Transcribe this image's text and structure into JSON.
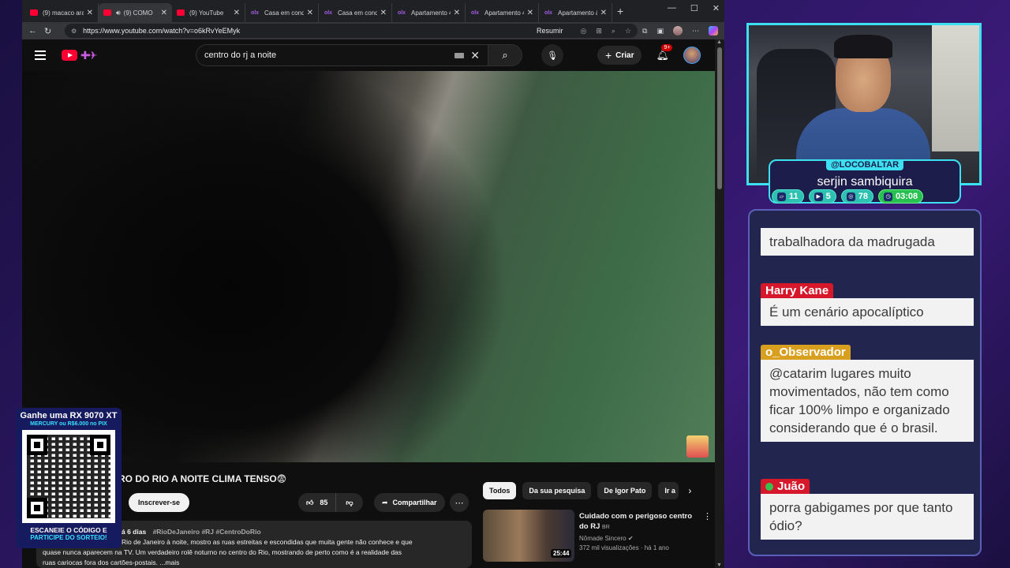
{
  "browser": {
    "tabs": [
      {
        "icon": "youtube",
        "title": "(9) macaco aran",
        "active": false,
        "audio": false
      },
      {
        "icon": "youtube",
        "title": "(9) COMO",
        "active": true,
        "audio": true
      },
      {
        "icon": "youtube",
        "title": "(9) YouTube",
        "active": false,
        "audio": false
      },
      {
        "icon": "olx",
        "title": "Casa em condo",
        "active": false,
        "audio": false
      },
      {
        "icon": "olx",
        "title": "Casa em condo",
        "active": false,
        "audio": false
      },
      {
        "icon": "olx",
        "title": "Apartamento 4",
        "active": false,
        "audio": false
      },
      {
        "icon": "olx",
        "title": "Apartamento 4",
        "active": false,
        "audio": false
      },
      {
        "icon": "olx",
        "title": "Apartamento à",
        "active": false,
        "audio": false
      }
    ],
    "olx_glyph": "olx",
    "close_glyph": "✕",
    "newtab_glyph": "+",
    "window_controls": {
      "minimize": "—",
      "maximize": "☐",
      "close": "✕"
    },
    "url": "https://www.youtube.com/watch?v=o6kRvYeEMyk",
    "resumir_label": "Resumir"
  },
  "youtube": {
    "search_query": "centro do rj a noite",
    "create_label": "Criar",
    "notifications_badge": "9+",
    "video_title": "RO DO RIO A NOITE CLIMA TENSO😨",
    "subscribe_label": "Inscrever-se",
    "like_count": "85",
    "share_label": "Compartilhar",
    "description": {
      "meta": "á 6 dias",
      "tags": "#RioDeJaneiro #RJ #CentroDoRio",
      "line1": "Rio de Janeiro à noite, mostro as ruas estreitas e escondidas que muita gente não conhece e que",
      "line2": "quase nunca aparecem na TV. Um verdadeiro rolê noturno no centro do Rio, mostrando de perto como é a realidade das",
      "line3": "ruas cariocas fora dos cartões-postais. ...mais"
    },
    "chips": [
      "Todos",
      "Da sua pesquisa",
      "De Igor Pato",
      "Ir a"
    ],
    "recommendation": {
      "title": "Cuidado com o perigoso centro do RJ",
      "region": "BR",
      "channel": "Nômade Sincero",
      "verified": "✔",
      "views": "372 mil visualizações · há 1 ano",
      "duration": "25:44"
    }
  },
  "giveaway": {
    "title": "Ganhe uma RX 9070 XT",
    "subtitle": "MERCURY ou R$6.000 no PIX",
    "footer1": "ESCANEIE O CÓDIGO E",
    "footer2": "PARTICIPE DO SORTEIO!"
  },
  "streamer": {
    "handle": "@LOCOBALTAR",
    "display_name": "serjin sambiquira",
    "stats": [
      {
        "icon": "twitch-icon",
        "value": "11"
      },
      {
        "icon": "youtube-icon",
        "value": "5"
      },
      {
        "icon": "kick-icon",
        "value": "78"
      },
      {
        "icon": "clock-icon",
        "value": "03:08"
      }
    ]
  },
  "chat": [
    {
      "user": "",
      "text": "trabalhadora da madrugada",
      "color": "#d6182a"
    },
    {
      "user": "Harry Kane",
      "text": "É um cenário apocalíptico",
      "color": "#d6182a"
    },
    {
      "user": "o_Observador",
      "text": "@catarim lugares muito movimentados, não tem como ficar 100% limpo e organizado considerando que é o brasil.",
      "color": "#d9a020"
    },
    {
      "user": "Juão",
      "text": "porra gabigames por que tanto ódio?",
      "color": "#d6182a"
    }
  ]
}
